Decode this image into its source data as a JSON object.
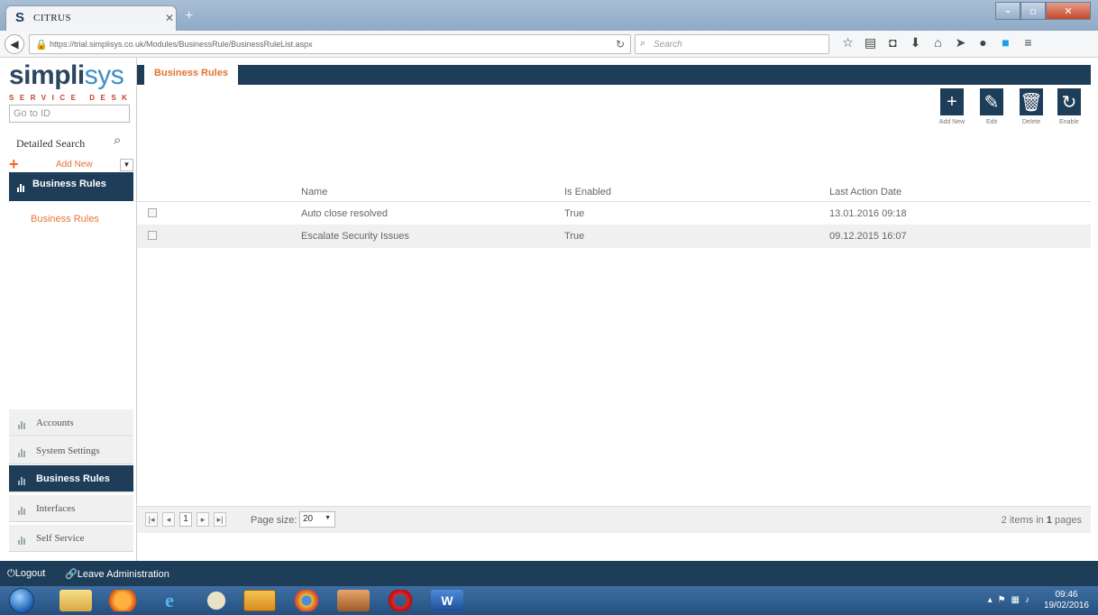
{
  "browser": {
    "tab_title": "CITRUS",
    "tab_favicon": "S",
    "url": "https://trial.simplisys.co.uk/Modules/BusinessRule/BusinessRuleList.aspx",
    "search_placeholder": "Search"
  },
  "sidebar": {
    "logo_main": "simpli",
    "logo_accent": "sys",
    "logo_sub": "SERVICE DESK",
    "goto_placeholder": "Go to ID",
    "detailed_search": "Detailed Search",
    "add_new": "Add New",
    "section_title": "Business Rules",
    "links": [
      "Business Rules"
    ],
    "accordion": [
      {
        "label": "Accounts",
        "active": false
      },
      {
        "label": "System Settings",
        "active": false
      },
      {
        "label": "Business Rules",
        "active": true
      },
      {
        "label": "Interfaces",
        "active": false
      },
      {
        "label": "Self Service",
        "active": false
      }
    ]
  },
  "main": {
    "tab": "Business Rules",
    "actions": [
      {
        "label": "Add New",
        "icon": "plus-icon"
      },
      {
        "label": "Edit",
        "icon": "edit-icon"
      },
      {
        "label": "Delete",
        "icon": "trash-icon"
      },
      {
        "label": "Enable",
        "icon": "refresh-icon"
      }
    ],
    "columns": [
      "Name",
      "Is Enabled",
      "Last Action Date"
    ],
    "rows": [
      {
        "name": "Auto close resolved",
        "enabled": "True",
        "date": "13.01.2016 09:18"
      },
      {
        "name": "Escalate Security Issues",
        "enabled": "True",
        "date": "09.12.2015 16:07"
      }
    ],
    "pager": {
      "current_page": "1",
      "page_size_label": "Page size:",
      "page_size": "20",
      "items": "2",
      "items_mid": "items in",
      "pages": "1",
      "pages_suffix": "pages"
    }
  },
  "footer": {
    "logout": "Logout",
    "leave_admin": "Leave Administration"
  },
  "taskbar": {
    "time": "09:46",
    "date": "19/02/2016"
  },
  "colors": {
    "navy": "#1e3d58",
    "orange": "#e2732f"
  }
}
